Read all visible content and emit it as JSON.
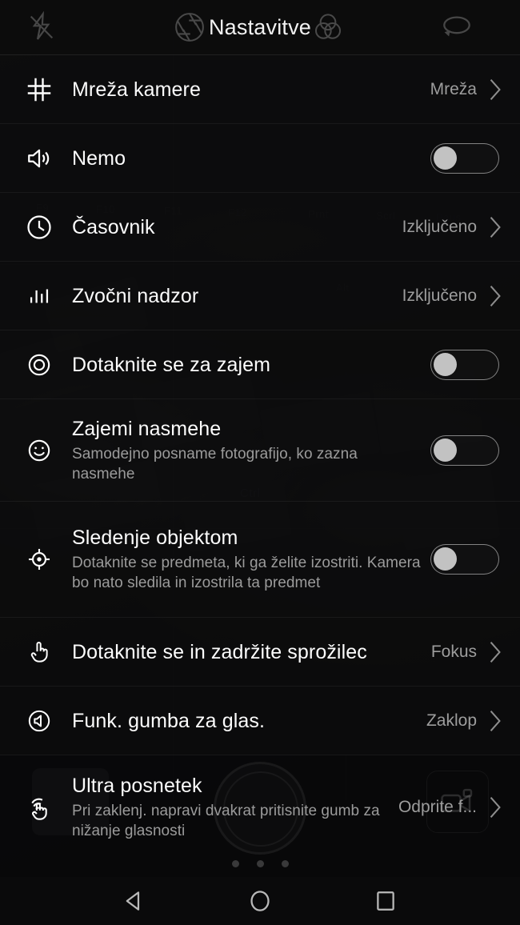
{
  "app": {
    "title": "Nastavitve",
    "colors": {
      "background": "#0e0e0e",
      "label": "#fcfcfc",
      "value": "#9d9d9d",
      "description": "#9b9b9b",
      "toggle_knob": "#c2c2c2",
      "divider": "rgba(255,255,255,.055)"
    }
  },
  "topbar": {
    "flash_icon": "flash-off-icon",
    "aperture_icon": "aperture-icon",
    "filter_icon": "color-filter-icon",
    "rotate_icon": "switch-camera-icon",
    "title": "Nastavitve"
  },
  "settings": [
    {
      "icon": "grid-icon",
      "label": "Mreža kamere",
      "description": "",
      "control": "value",
      "value": "Mreža"
    },
    {
      "icon": "speaker-icon",
      "label": "Nemo",
      "description": "",
      "control": "toggle",
      "value": "off"
    },
    {
      "icon": "clock-icon",
      "label": "Časovnik",
      "description": "",
      "control": "value",
      "value": "Izključeno"
    },
    {
      "icon": "audio-levels-icon",
      "label": "Zvočni nadzor",
      "description": "",
      "control": "value",
      "value": "Izključeno"
    },
    {
      "icon": "target-circle-icon",
      "label": "Dotaknite se za zajem",
      "description": "",
      "control": "toggle",
      "value": "off"
    },
    {
      "icon": "smile-icon",
      "label": "Zajemi nasmehe",
      "description": "Samodejno posname fotografijo, ko zazna nasmehe",
      "control": "toggle",
      "value": "off"
    },
    {
      "icon": "crosshair-icon",
      "label": "Sledenje objektom",
      "description": "Dotaknite se predmeta, ki ga želite izostriti. Kamera bo nato sledila in izostrila ta predmet",
      "control": "toggle",
      "value": "off"
    },
    {
      "icon": "hand-pointer-icon",
      "label": "Dotaknite se in zadržite sprožilec",
      "description": "",
      "control": "value",
      "value": "Fokus"
    },
    {
      "icon": "volume-circle-icon",
      "label": "Funk. gumba za glas.",
      "description": "",
      "control": "value",
      "value": "Zaklop"
    },
    {
      "icon": "double-tap-hand-icon",
      "label": "Ultra posnetek",
      "description": "Pri zaklenj. napravi dvakrat pritisnite gumb za nižanje glasnosti",
      "control": "value",
      "value": "Odprite f..."
    }
  ],
  "camera_controls": {
    "shutter_button": "shutter-button",
    "gallery_thumb": "gallery-thumbnail",
    "video_button": "video-mode-button",
    "mode_dots": 3
  },
  "navbar": {
    "back": "back-button",
    "home": "home-button",
    "recents": "recents-button"
  }
}
